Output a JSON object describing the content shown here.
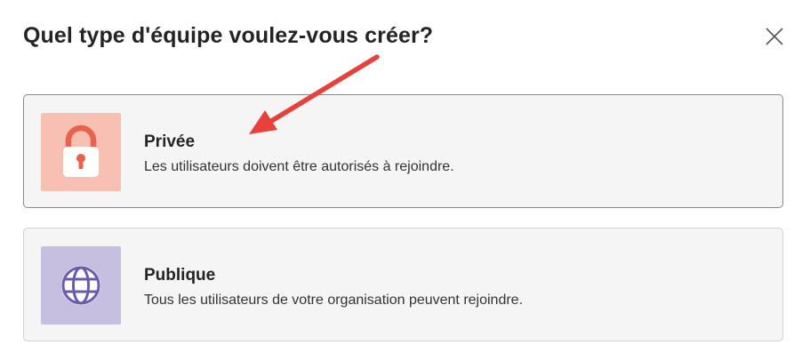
{
  "dialog": {
    "title": "Quel type d'équipe voulez-vous créer?",
    "close_icon": "close-icon"
  },
  "options": [
    {
      "id": "private",
      "title": "Privée",
      "description": "Les utilisateurs doivent être autorisés à rejoindre.",
      "icon": "lock-icon",
      "tile_color": "#f8c0b3",
      "icon_color": "#e8624d"
    },
    {
      "id": "public",
      "title": "Publique",
      "description": "Tous les utilisateurs de votre organisation peuvent rejoindre.",
      "icon": "globe-icon",
      "tile_color": "#c6bfdf",
      "icon_color": "#6b5bad"
    }
  ],
  "annotation": {
    "arrow_color": "#e8413c"
  }
}
